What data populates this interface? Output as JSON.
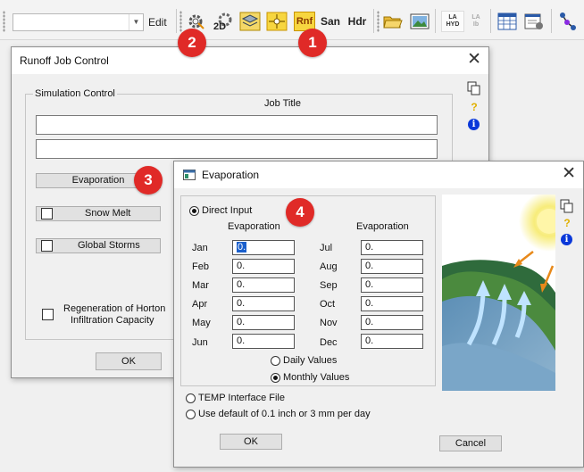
{
  "toolbar": {
    "combo_value": "",
    "edit_label": "Edit",
    "buttons": [
      {
        "name": "gear-run-icon"
      },
      {
        "name": "2d-gear-icon"
      },
      {
        "name": "layers-icon"
      },
      {
        "name": "node-icon"
      },
      {
        "name": "runoff-button",
        "label": "Rnf"
      },
      {
        "name": "sanitary-button",
        "label": "San"
      },
      {
        "name": "hydraulics-button",
        "label": "Hdr"
      },
      {
        "name": "open-folder-icon"
      },
      {
        "name": "picture-icon"
      },
      {
        "name": "la-hyd-button",
        "label_top": "LA",
        "label_bottom": "HYD"
      },
      {
        "name": "la-ib-button",
        "label_top": "LA",
        "label_bottom": "Ib"
      },
      {
        "name": "table-icon"
      },
      {
        "name": "form-icon"
      },
      {
        "name": "network-icon"
      }
    ]
  },
  "badges": [
    "1",
    "2",
    "3",
    "4"
  ],
  "runoff": {
    "title": "Runoff Job Control",
    "group_label": "Simulation Control",
    "job_title_label": "Job Title",
    "job_title_line1": "",
    "job_title_line2": "",
    "evaporation_button": "Evaporation",
    "snow_melt": "Snow Melt",
    "global_storms": "Global Storms",
    "regeneration_line1": "Regeneration of Horton",
    "regeneration_line2": "Infiltration Capacity",
    "ok": "OK"
  },
  "evap": {
    "title": "Evaporation",
    "direct_input": "Direct Input",
    "col_header_left": "Evaporation",
    "col_header_right": "Evaporation",
    "months_left": [
      {
        "month": "Jan",
        "value": "0."
      },
      {
        "month": "Feb",
        "value": "0."
      },
      {
        "month": "Mar",
        "value": "0."
      },
      {
        "month": "Apr",
        "value": "0."
      },
      {
        "month": "May",
        "value": "0."
      },
      {
        "month": "Jun",
        "value": "0."
      }
    ],
    "months_right": [
      {
        "month": "Jul",
        "value": "0."
      },
      {
        "month": "Aug",
        "value": "0."
      },
      {
        "month": "Sep",
        "value": "0."
      },
      {
        "month": "Oct",
        "value": "0."
      },
      {
        "month": "Nov",
        "value": "0."
      },
      {
        "month": "Dec",
        "value": "0."
      }
    ],
    "daily_values": "Daily Values",
    "monthly_values": "Monthly Values",
    "temp_interface": "TEMP Interface File",
    "use_default": "Use default of 0.1 inch or 3 mm per day",
    "ok": "OK",
    "cancel": "Cancel"
  },
  "colors": {
    "badge": "#e02a27",
    "rnf_highlight": "#f7d640",
    "info_blue": "#0a38d9",
    "selection_blue": "#1a5fcc"
  }
}
